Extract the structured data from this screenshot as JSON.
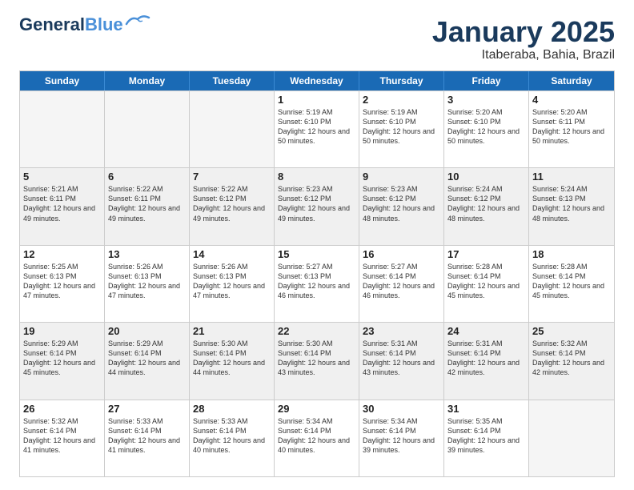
{
  "header": {
    "logo_line1": "General",
    "logo_line2": "Blue",
    "month": "January 2025",
    "location": "Itaberaba, Bahia, Brazil"
  },
  "days_of_week": [
    "Sunday",
    "Monday",
    "Tuesday",
    "Wednesday",
    "Thursday",
    "Friday",
    "Saturday"
  ],
  "weeks": [
    [
      {
        "day": "",
        "sunrise": "",
        "sunset": "",
        "daylight": "",
        "empty": true
      },
      {
        "day": "",
        "sunrise": "",
        "sunset": "",
        "daylight": "",
        "empty": true
      },
      {
        "day": "",
        "sunrise": "",
        "sunset": "",
        "daylight": "",
        "empty": true
      },
      {
        "day": "1",
        "sunrise": "Sunrise: 5:19 AM",
        "sunset": "Sunset: 6:10 PM",
        "daylight": "Daylight: 12 hours and 50 minutes.",
        "empty": false
      },
      {
        "day": "2",
        "sunrise": "Sunrise: 5:19 AM",
        "sunset": "Sunset: 6:10 PM",
        "daylight": "Daylight: 12 hours and 50 minutes.",
        "empty": false
      },
      {
        "day": "3",
        "sunrise": "Sunrise: 5:20 AM",
        "sunset": "Sunset: 6:10 PM",
        "daylight": "Daylight: 12 hours and 50 minutes.",
        "empty": false
      },
      {
        "day": "4",
        "sunrise": "Sunrise: 5:20 AM",
        "sunset": "Sunset: 6:11 PM",
        "daylight": "Daylight: 12 hours and 50 minutes.",
        "empty": false
      }
    ],
    [
      {
        "day": "5",
        "sunrise": "Sunrise: 5:21 AM",
        "sunset": "Sunset: 6:11 PM",
        "daylight": "Daylight: 12 hours and 49 minutes.",
        "empty": false
      },
      {
        "day": "6",
        "sunrise": "Sunrise: 5:22 AM",
        "sunset": "Sunset: 6:11 PM",
        "daylight": "Daylight: 12 hours and 49 minutes.",
        "empty": false
      },
      {
        "day": "7",
        "sunrise": "Sunrise: 5:22 AM",
        "sunset": "Sunset: 6:12 PM",
        "daylight": "Daylight: 12 hours and 49 minutes.",
        "empty": false
      },
      {
        "day": "8",
        "sunrise": "Sunrise: 5:23 AM",
        "sunset": "Sunset: 6:12 PM",
        "daylight": "Daylight: 12 hours and 49 minutes.",
        "empty": false
      },
      {
        "day": "9",
        "sunrise": "Sunrise: 5:23 AM",
        "sunset": "Sunset: 6:12 PM",
        "daylight": "Daylight: 12 hours and 48 minutes.",
        "empty": false
      },
      {
        "day": "10",
        "sunrise": "Sunrise: 5:24 AM",
        "sunset": "Sunset: 6:12 PM",
        "daylight": "Daylight: 12 hours and 48 minutes.",
        "empty": false
      },
      {
        "day": "11",
        "sunrise": "Sunrise: 5:24 AM",
        "sunset": "Sunset: 6:13 PM",
        "daylight": "Daylight: 12 hours and 48 minutes.",
        "empty": false
      }
    ],
    [
      {
        "day": "12",
        "sunrise": "Sunrise: 5:25 AM",
        "sunset": "Sunset: 6:13 PM",
        "daylight": "Daylight: 12 hours and 47 minutes.",
        "empty": false
      },
      {
        "day": "13",
        "sunrise": "Sunrise: 5:26 AM",
        "sunset": "Sunset: 6:13 PM",
        "daylight": "Daylight: 12 hours and 47 minutes.",
        "empty": false
      },
      {
        "day": "14",
        "sunrise": "Sunrise: 5:26 AM",
        "sunset": "Sunset: 6:13 PM",
        "daylight": "Daylight: 12 hours and 47 minutes.",
        "empty": false
      },
      {
        "day": "15",
        "sunrise": "Sunrise: 5:27 AM",
        "sunset": "Sunset: 6:13 PM",
        "daylight": "Daylight: 12 hours and 46 minutes.",
        "empty": false
      },
      {
        "day": "16",
        "sunrise": "Sunrise: 5:27 AM",
        "sunset": "Sunset: 6:14 PM",
        "daylight": "Daylight: 12 hours and 46 minutes.",
        "empty": false
      },
      {
        "day": "17",
        "sunrise": "Sunrise: 5:28 AM",
        "sunset": "Sunset: 6:14 PM",
        "daylight": "Daylight: 12 hours and 45 minutes.",
        "empty": false
      },
      {
        "day": "18",
        "sunrise": "Sunrise: 5:28 AM",
        "sunset": "Sunset: 6:14 PM",
        "daylight": "Daylight: 12 hours and 45 minutes.",
        "empty": false
      }
    ],
    [
      {
        "day": "19",
        "sunrise": "Sunrise: 5:29 AM",
        "sunset": "Sunset: 6:14 PM",
        "daylight": "Daylight: 12 hours and 45 minutes.",
        "empty": false
      },
      {
        "day": "20",
        "sunrise": "Sunrise: 5:29 AM",
        "sunset": "Sunset: 6:14 PM",
        "daylight": "Daylight: 12 hours and 44 minutes.",
        "empty": false
      },
      {
        "day": "21",
        "sunrise": "Sunrise: 5:30 AM",
        "sunset": "Sunset: 6:14 PM",
        "daylight": "Daylight: 12 hours and 44 minutes.",
        "empty": false
      },
      {
        "day": "22",
        "sunrise": "Sunrise: 5:30 AM",
        "sunset": "Sunset: 6:14 PM",
        "daylight": "Daylight: 12 hours and 43 minutes.",
        "empty": false
      },
      {
        "day": "23",
        "sunrise": "Sunrise: 5:31 AM",
        "sunset": "Sunset: 6:14 PM",
        "daylight": "Daylight: 12 hours and 43 minutes.",
        "empty": false
      },
      {
        "day": "24",
        "sunrise": "Sunrise: 5:31 AM",
        "sunset": "Sunset: 6:14 PM",
        "daylight": "Daylight: 12 hours and 42 minutes.",
        "empty": false
      },
      {
        "day": "25",
        "sunrise": "Sunrise: 5:32 AM",
        "sunset": "Sunset: 6:14 PM",
        "daylight": "Daylight: 12 hours and 42 minutes.",
        "empty": false
      }
    ],
    [
      {
        "day": "26",
        "sunrise": "Sunrise: 5:32 AM",
        "sunset": "Sunset: 6:14 PM",
        "daylight": "Daylight: 12 hours and 41 minutes.",
        "empty": false
      },
      {
        "day": "27",
        "sunrise": "Sunrise: 5:33 AM",
        "sunset": "Sunset: 6:14 PM",
        "daylight": "Daylight: 12 hours and 41 minutes.",
        "empty": false
      },
      {
        "day": "28",
        "sunrise": "Sunrise: 5:33 AM",
        "sunset": "Sunset: 6:14 PM",
        "daylight": "Daylight: 12 hours and 40 minutes.",
        "empty": false
      },
      {
        "day": "29",
        "sunrise": "Sunrise: 5:34 AM",
        "sunset": "Sunset: 6:14 PM",
        "daylight": "Daylight: 12 hours and 40 minutes.",
        "empty": false
      },
      {
        "day": "30",
        "sunrise": "Sunrise: 5:34 AM",
        "sunset": "Sunset: 6:14 PM",
        "daylight": "Daylight: 12 hours and 39 minutes.",
        "empty": false
      },
      {
        "day": "31",
        "sunrise": "Sunrise: 5:35 AM",
        "sunset": "Sunset: 6:14 PM",
        "daylight": "Daylight: 12 hours and 39 minutes.",
        "empty": false
      },
      {
        "day": "",
        "sunrise": "",
        "sunset": "",
        "daylight": "",
        "empty": true
      }
    ]
  ]
}
